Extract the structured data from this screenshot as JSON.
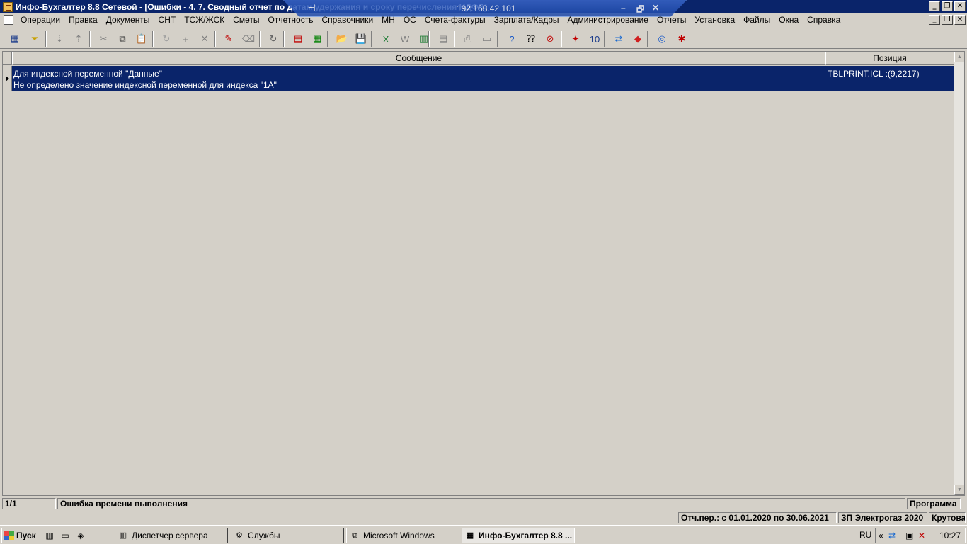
{
  "window": {
    "title": "Инфо-Бухгалтер 8.8 Сетевой - [Ошибки - 4. 7. Сводный отчет по датам удержания и сроку перечисления НДФЛ]"
  },
  "rdp": {
    "ip": "192.168.42.101",
    "pin": "⊣",
    "minimize": "–",
    "restore": "🗗",
    "close": "✕"
  },
  "window_controls": {
    "minimize": "_",
    "restore": "❐",
    "close": "✕"
  },
  "menu": {
    "items": [
      "Операции",
      "Правка",
      "Документы",
      "СНТ",
      "ТСЖ/ЖСК",
      "Сметы",
      "Отчетность",
      "Справочники",
      "МН",
      "ОС",
      "Счета-фактуры",
      "Зарплата/Кадры",
      "Администрирование",
      "Отчеты",
      "Установка",
      "Файлы",
      "Окна",
      "Справка"
    ]
  },
  "toolbar": {
    "icons": [
      {
        "name": "grid-view-icon",
        "glyph": "▦",
        "color": "#1a3a8a"
      },
      {
        "name": "filter-icon",
        "glyph": "⏷",
        "color": "#c8a000"
      },
      {
        "name": "sort-asc-icon",
        "glyph": "⇣",
        "color": "#808080"
      },
      {
        "name": "sort-desc-icon",
        "glyph": "⇡",
        "color": "#808080"
      },
      {
        "name": "cut-icon",
        "glyph": "✂",
        "color": "#808080"
      },
      {
        "name": "copy-icon",
        "glyph": "⧉",
        "color": "#404040"
      },
      {
        "name": "paste-icon",
        "glyph": "📋",
        "color": "#808080"
      },
      {
        "name": "rotate-icon",
        "glyph": "↻",
        "color": "#a0a0a0"
      },
      {
        "name": "add-icon",
        "glyph": "+",
        "color": "#808080"
      },
      {
        "name": "delete-icon",
        "glyph": "✕",
        "color": "#808080"
      },
      {
        "name": "highlight-icon",
        "glyph": "✎",
        "color": "#c00000"
      },
      {
        "name": "clear-icon",
        "glyph": "⌫",
        "color": "#808080"
      },
      {
        "name": "refresh-icon",
        "glyph": "↻",
        "color": "#606060"
      },
      {
        "name": "calendar-icon",
        "glyph": "▤",
        "color": "#c00000"
      },
      {
        "name": "calculator-icon",
        "glyph": "▦",
        "color": "#008000"
      },
      {
        "name": "open-folder-icon",
        "glyph": "📂",
        "color": "#808080"
      },
      {
        "name": "save-icon",
        "glyph": "💾",
        "color": "#808080"
      },
      {
        "name": "excel-icon",
        "glyph": "X",
        "color": "#1e7b34"
      },
      {
        "name": "word-icon",
        "glyph": "W",
        "color": "#808080"
      },
      {
        "name": "export-icon",
        "glyph": "▥",
        "color": "#1e7b34"
      },
      {
        "name": "print-preview-icon",
        "glyph": "▤",
        "color": "#808080"
      },
      {
        "name": "print-icon",
        "glyph": "⎙",
        "color": "#808080"
      },
      {
        "name": "page-setup-icon",
        "glyph": "▭",
        "color": "#808080"
      },
      {
        "name": "help-icon",
        "glyph": "?",
        "color": "#1a5ac8"
      },
      {
        "name": "context-help-icon",
        "glyph": "⁇",
        "color": "#000000"
      },
      {
        "name": "navigator-icon",
        "glyph": "⊘",
        "color": "#c00000"
      },
      {
        "name": "colorful-app-icon",
        "glyph": "✦",
        "color": "#c00000"
      },
      {
        "name": "ib10-icon",
        "glyph": "10",
        "color": "#1a3a8a"
      },
      {
        "name": "teamviewer-icon",
        "glyph": "⇄",
        "color": "#1a6ad0"
      },
      {
        "name": "anydesk-icon",
        "glyph": "◆",
        "color": "#d02020"
      },
      {
        "name": "internet-icon",
        "glyph": "◎",
        "color": "#1a5ac8"
      },
      {
        "name": "settings-network-icon",
        "glyph": "✱",
        "color": "#c00000"
      }
    ]
  },
  "grid": {
    "columns": [
      "Сообщение",
      "Позиция"
    ],
    "rows": [
      {
        "message_line1": "Для индексной переменной \"Данные\"",
        "message_line2": "Не определено значение индексной переменной для индекса \"1А\"",
        "position": "TBLPRINT.ICL :(9,2217)"
      }
    ]
  },
  "status": {
    "counter": "1/1",
    "error": "Ошибка времени выполнения",
    "program": "Программа",
    "period": "Отч.пер.: с 01.01.2020 по 30.06.2021",
    "org": "ЗП Электрогаз 2020",
    "user": "Крутова"
  },
  "taskbar": {
    "start": "Пуск",
    "tasks": [
      {
        "label": "Диспетчер сервера",
        "icon": "▥"
      },
      {
        "label": "Службы",
        "icon": "⚙"
      },
      {
        "label": "Microsoft Windows",
        "icon": "⧉"
      },
      {
        "label": "Инфо-Бухгалтер 8.8 ...",
        "icon": "▦"
      }
    ],
    "lang": "RU",
    "clock": "10:27"
  }
}
